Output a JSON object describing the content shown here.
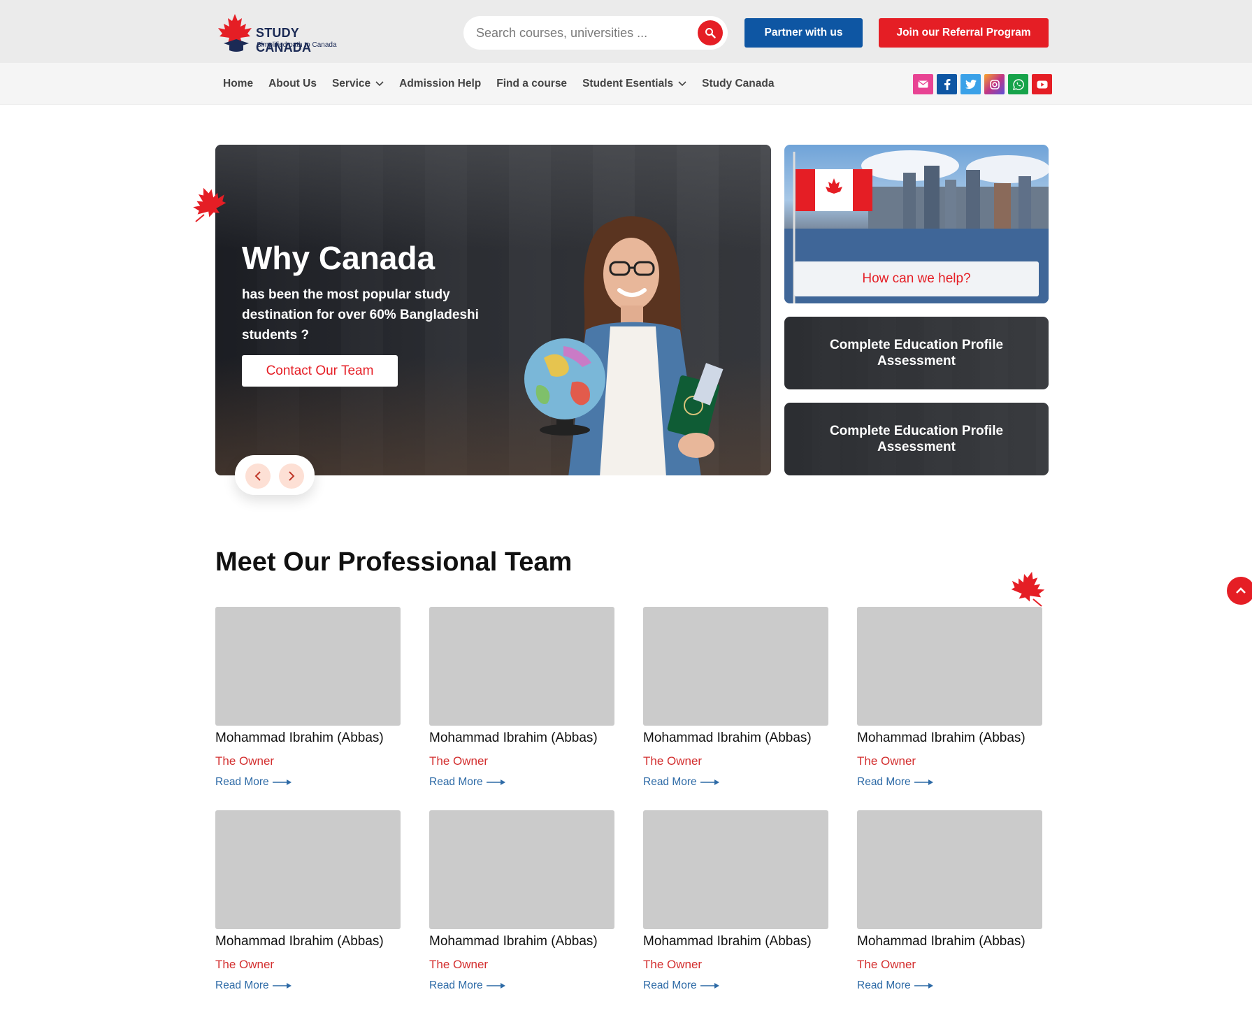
{
  "brand": {
    "name": "STUDY CANADA",
    "tagline": "Simplified path to Canada"
  },
  "search": {
    "placeholder": "Search courses, universities ..."
  },
  "header_buttons": {
    "partner": "Partner with us",
    "referral": "Join our Referral Program"
  },
  "nav": {
    "items": [
      {
        "label": "Home",
        "dropdown": false
      },
      {
        "label": "About Us",
        "dropdown": false
      },
      {
        "label": "Service",
        "dropdown": true
      },
      {
        "label": "Admission Help",
        "dropdown": false
      },
      {
        "label": "Find a course",
        "dropdown": false
      },
      {
        "label": "Student Esentials",
        "dropdown": true
      },
      {
        "label": "Study Canada",
        "dropdown": false
      }
    ],
    "social": [
      {
        "icon": "email-icon",
        "color": "#e84393"
      },
      {
        "icon": "facebook-icon",
        "color": "#0e56a3"
      },
      {
        "icon": "twitter-icon",
        "color": "#3aa1e8"
      },
      {
        "icon": "instagram-icon",
        "color": "#c13584"
      },
      {
        "icon": "whatsapp-icon",
        "color": "#16a34a"
      },
      {
        "icon": "youtube-icon",
        "color": "#e51e25"
      }
    ]
  },
  "hero": {
    "title": "Why Canada",
    "text": "has been the most popular study destination for over 60% Bangladeshi students ?",
    "cta": "Contact Our Team"
  },
  "side_cards": {
    "help": "How can we help?",
    "card1": "Complete Education Profile Assessment",
    "card2": "Complete Education Profile Assessment"
  },
  "team": {
    "title": "Meet Our Professional Team",
    "members": [
      {
        "name": "Mohammad Ibrahim (Abbas)",
        "role": "The Owner",
        "link": "Read More"
      },
      {
        "name": "Mohammad Ibrahim (Abbas)",
        "role": "The Owner",
        "link": "Read More"
      },
      {
        "name": "Mohammad Ibrahim (Abbas)",
        "role": "The Owner",
        "link": "Read More"
      },
      {
        "name": "Mohammad Ibrahim (Abbas)",
        "role": "The Owner",
        "link": "Read More"
      },
      {
        "name": "Mohammad Ibrahim (Abbas)",
        "role": "The Owner",
        "link": "Read More"
      },
      {
        "name": "Mohammad Ibrahim (Abbas)",
        "role": "The Owner",
        "link": "Read More"
      },
      {
        "name": "Mohammad Ibrahim (Abbas)",
        "role": "The Owner",
        "link": "Read More"
      },
      {
        "name": "Mohammad Ibrahim (Abbas)",
        "role": "The Owner",
        "link": "Read More"
      }
    ]
  },
  "colors": {
    "brand_red": "#e51e25",
    "brand_blue": "#0e56a3",
    "navy": "#1b2a55"
  }
}
